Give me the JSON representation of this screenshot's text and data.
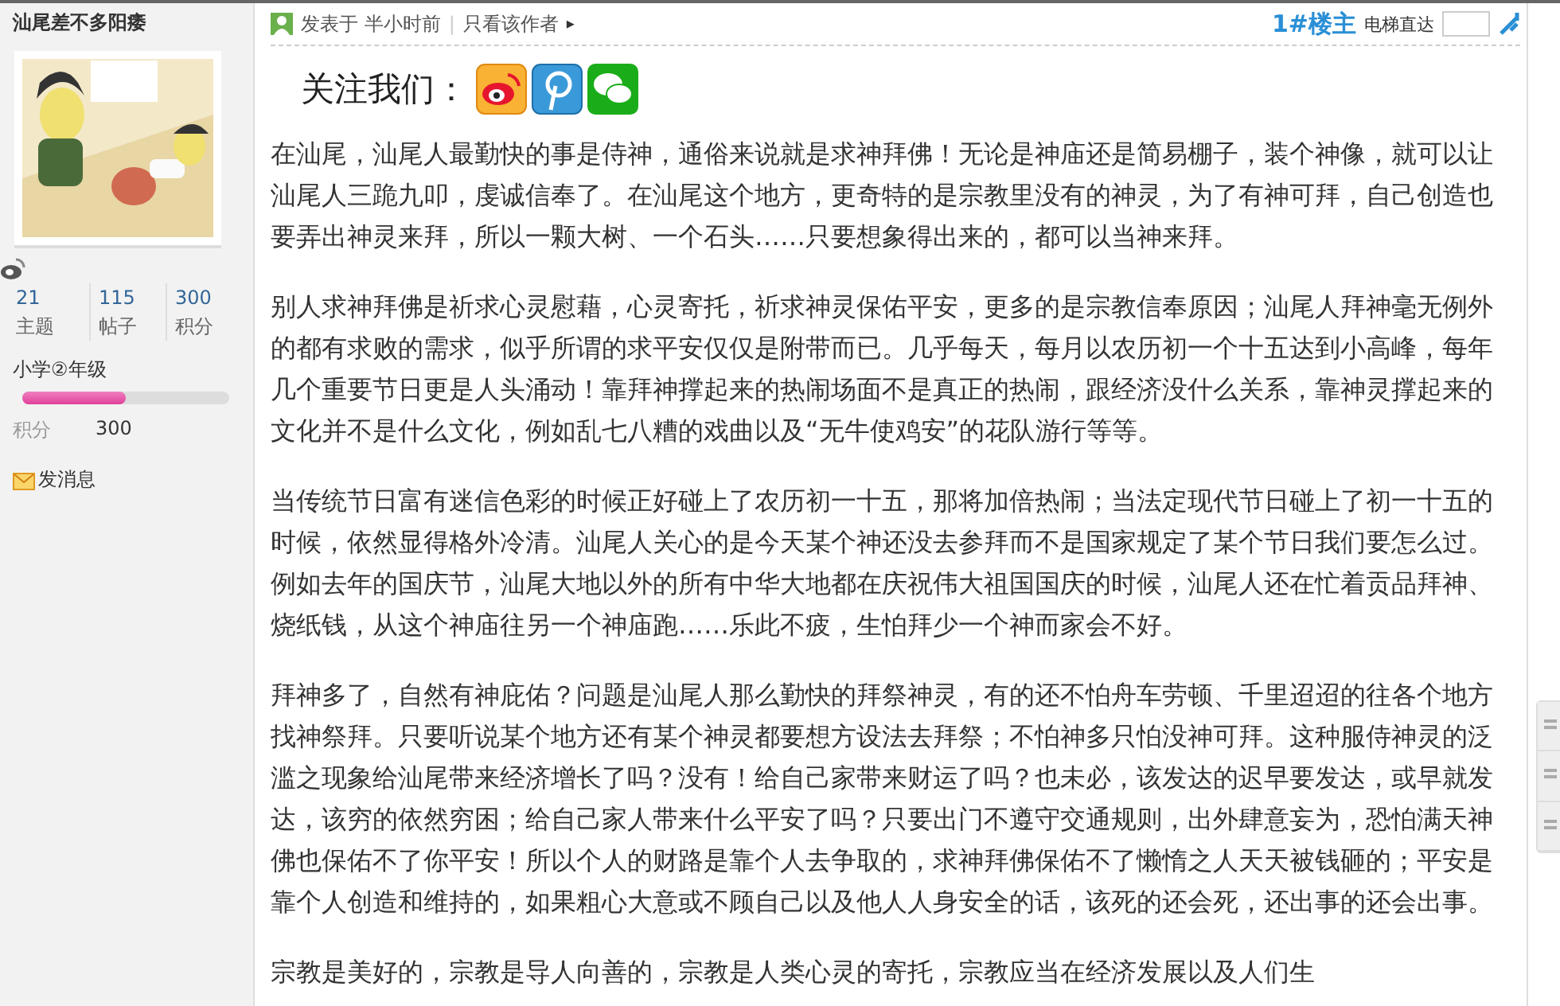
{
  "author": {
    "name": "汕尾差不多阳痿",
    "stats": [
      {
        "value": "21",
        "label": "主题"
      },
      {
        "value": "115",
        "label": "帖子"
      },
      {
        "value": "300",
        "label": "积分"
      }
    ],
    "rank": {
      "title": "小学②年级",
      "level": 0.5
    },
    "points": {
      "label": "积分",
      "value": "300"
    },
    "message_link": "发消息"
  },
  "post": {
    "posted": "发表于 半小时前",
    "separator": "|",
    "author_only": "只看该作者",
    "author_only_arrow": "▸",
    "floor": "1#楼主",
    "jump_label": "电梯直达",
    "follow_label": "关注我们：",
    "paragraphs": [
      "在汕尾，汕尾人最勤快的事是侍神，通俗来说就是求神拜佛！无论是神庙还是简易棚子，装个神像，就可以让汕尾人三跪九叩，虔诚信奉了。在汕尾这个地方，更奇特的是宗教里没有的神灵，为了有神可拜，自己创造也要弄出神灵来拜，所以一颗大树、一个石头……只要想象得出来的，都可以当神来拜。",
      "别人求神拜佛是祈求心灵慰藉，心灵寄托，祈求神灵保佑平安，更多的是宗教信奉原因；汕尾人拜神毫无例外的都有求败的需求，似乎所谓的求平安仅仅是附带而已。几乎每天，每月以农历初一个十五达到小高峰，每年几个重要节日更是人头涌动！靠拜神撑起来的热闹场面不是真正的热闹，跟经济没什么关系，靠神灵撑起来的文化并不是什么文化，例如乱七八糟的戏曲以及“无牛使鸡安”的花队游行等等。",
      "当传统节日富有迷信色彩的时候正好碰上了农历初一十五，那将加倍热闹；当法定现代节日碰上了初一十五的时候，依然显得格外冷清。汕尾人关心的是今天某个神还没去参拜而不是国家规定了某个节日我们要怎么过。例如去年的国庆节，汕尾大地以外的所有中华大地都在庆祝伟大祖国国庆的时候，汕尾人还在忙着贡品拜神、烧纸钱，从这个神庙往另一个神庙跑……乐此不疲，生怕拜少一个神而家会不好。",
      "拜神多了，自然有神庇佑？问题是汕尾人那么勤快的拜祭神灵，有的还不怕舟车劳顿、千里迢迢的往各个地方找神祭拜。只要听说某个地方还有某个神灵都要想方设法去拜祭；不怕神多只怕没神可拜。这种服侍神灵的泛滥之现象给汕尾带来经济增长了吗？没有！给自己家带来财运了吗？也未必，该发达的迟早要发达，或早就发达，该穷的依然穷困；给自己家人带来什么平安了吗？只要出门不遵守交通规则，出外肆意妄为，恐怕满天神佛也保佑不了你平安！所以个人的财路是靠个人去争取的，求神拜佛保佑不了懒惰之人天天被钱砸的；平安是靠个人创造和维持的，如果粗心大意或不顾自己以及他人人身安全的话，该死的还会死，还出事的还会出事。",
      "宗教是美好的，宗教是导人向善的，宗教是人类心灵的寄托，宗教应当在经济发展以及人们生"
    ]
  }
}
